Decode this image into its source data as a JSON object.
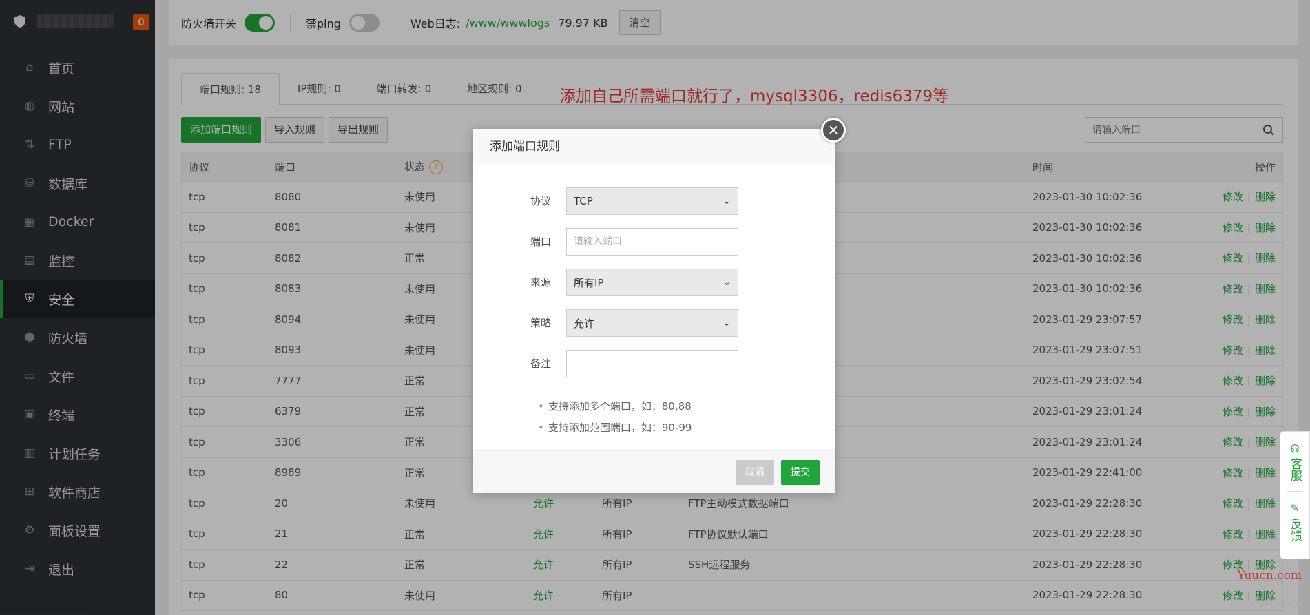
{
  "sidebar": {
    "badge": "0",
    "items": [
      {
        "label": "首页",
        "icon": "home-icon",
        "glyph": "⌂"
      },
      {
        "label": "网站",
        "icon": "globe-icon",
        "glyph": "◍"
      },
      {
        "label": "FTP",
        "icon": "ftp-icon",
        "glyph": "⇅"
      },
      {
        "label": "数据库",
        "icon": "database-icon",
        "glyph": "⛁"
      },
      {
        "label": "Docker",
        "icon": "docker-icon",
        "glyph": "▦"
      },
      {
        "label": "监控",
        "icon": "monitor-icon",
        "glyph": "▤"
      },
      {
        "label": "安全",
        "icon": "shield-icon",
        "glyph": "⛨"
      },
      {
        "label": "防火墙",
        "icon": "firewall-icon",
        "glyph": "⬢"
      },
      {
        "label": "文件",
        "icon": "folder-icon",
        "glyph": "▭"
      },
      {
        "label": "终端",
        "icon": "terminal-icon",
        "glyph": "▣"
      },
      {
        "label": "计划任务",
        "icon": "calendar-icon",
        "glyph": "▥"
      },
      {
        "label": "软件商店",
        "icon": "apps-icon",
        "glyph": "⊞"
      },
      {
        "label": "面板设置",
        "icon": "gear-icon",
        "glyph": "⚙"
      },
      {
        "label": "退出",
        "icon": "logout-icon",
        "glyph": "⇥"
      }
    ]
  },
  "topbar": {
    "firewall_label": "防火墙开关",
    "ping_label": "禁ping",
    "weblog_label": "Web日志:",
    "weblog_path": "/www/wwwlogs",
    "weblog_size": "79.97 KB",
    "clear_label": "清空"
  },
  "tabs": [
    {
      "label": "端口规则: 18"
    },
    {
      "label": "IP规则: 0"
    },
    {
      "label": "端口转发: 0"
    },
    {
      "label": "地区规则: 0"
    }
  ],
  "annotation": "添加自己所需端口就行了，mysql3306，redis6379等",
  "actions": {
    "add_label": "添加端口规则",
    "import_label": "导入规则",
    "export_label": "导出规则"
  },
  "search": {
    "placeholder": "请输入端口"
  },
  "table": {
    "headers": {
      "proto": "协议",
      "port": "端口",
      "status": "状态",
      "time": "时间",
      "ops": "操作"
    },
    "rows": [
      {
        "proto": "tcp",
        "port": "8080",
        "status": "未使用",
        "policy": "",
        "source": "",
        "note": "",
        "time": "2023-01-30 10:02:36"
      },
      {
        "proto": "tcp",
        "port": "8081",
        "status": "未使用",
        "policy": "",
        "source": "",
        "note": "",
        "time": "2023-01-30 10:02:36"
      },
      {
        "proto": "tcp",
        "port": "8082",
        "status": "正常",
        "policy": "",
        "source": "",
        "note": "",
        "time": "2023-01-30 10:02:36"
      },
      {
        "proto": "tcp",
        "port": "8083",
        "status": "未使用",
        "policy": "",
        "source": "",
        "note": "",
        "time": "2023-01-30 10:02:36"
      },
      {
        "proto": "tcp",
        "port": "8094",
        "status": "未使用",
        "policy": "",
        "source": "",
        "note": "",
        "time": "2023-01-29 23:07:57"
      },
      {
        "proto": "tcp",
        "port": "8093",
        "status": "未使用",
        "policy": "",
        "source": "",
        "note": "",
        "time": "2023-01-29 23:07:51"
      },
      {
        "proto": "tcp",
        "port": "7777",
        "status": "正常",
        "policy": "",
        "source": "",
        "note": "",
        "time": "2023-01-29 23:02:54"
      },
      {
        "proto": "tcp",
        "port": "6379",
        "status": "正常",
        "policy": "",
        "source": "",
        "note": "",
        "time": "2023-01-29 23:01:24"
      },
      {
        "proto": "tcp",
        "port": "3306",
        "status": "正常",
        "policy": "",
        "source": "",
        "note": "",
        "time": "2023-01-29 23:01:24"
      },
      {
        "proto": "tcp",
        "port": "8989",
        "status": "正常",
        "policy": "",
        "source": "",
        "note": "",
        "time": "2023-01-29 22:41:00"
      },
      {
        "proto": "tcp",
        "port": "20",
        "status": "未使用",
        "policy": "允许",
        "source": "所有IP",
        "note": "FTP主动模式数据端口",
        "time": "2023-01-29 22:28:30"
      },
      {
        "proto": "tcp",
        "port": "21",
        "status": "正常",
        "policy": "允许",
        "source": "所有IP",
        "note": "FTP协议默认端口",
        "time": "2023-01-29 22:28:30"
      },
      {
        "proto": "tcp",
        "port": "22",
        "status": "正常",
        "policy": "允许",
        "source": "所有IP",
        "note": "SSH远程服务",
        "time": "2023-01-29 22:28:30"
      },
      {
        "proto": "tcp",
        "port": "80",
        "status": "未使用",
        "policy": "允许",
        "source": "所有IP",
        "note": "",
        "time": "2023-01-29 22:28:30"
      }
    ],
    "edit_label": "修改",
    "op_sep": "|",
    "delete_label": "删除"
  },
  "modal": {
    "title": "添加端口规则",
    "protocol_label": "协议",
    "protocol_value": "TCP",
    "port_label": "端口",
    "port_placeholder": "请输入端口",
    "source_label": "来源",
    "source_value": "所有IP",
    "policy_label": "策略",
    "policy_value": "允许",
    "note_label": "备注",
    "note_value": "",
    "tips": [
      "支持添加多个端口，如：80,88",
      "支持添加范围端口，如：90-99"
    ],
    "cancel_label": "取消",
    "submit_label": "提交"
  },
  "float": {
    "service_label": "客服",
    "feedback_label": "反馈"
  },
  "watermark": "Yuucn.com",
  "credit": "CSDN @Mast514",
  "colors": {
    "accent": "#20a53a",
    "badge": "#e8590c",
    "annotation": "#e53935",
    "sidebar": "#2d3234"
  }
}
